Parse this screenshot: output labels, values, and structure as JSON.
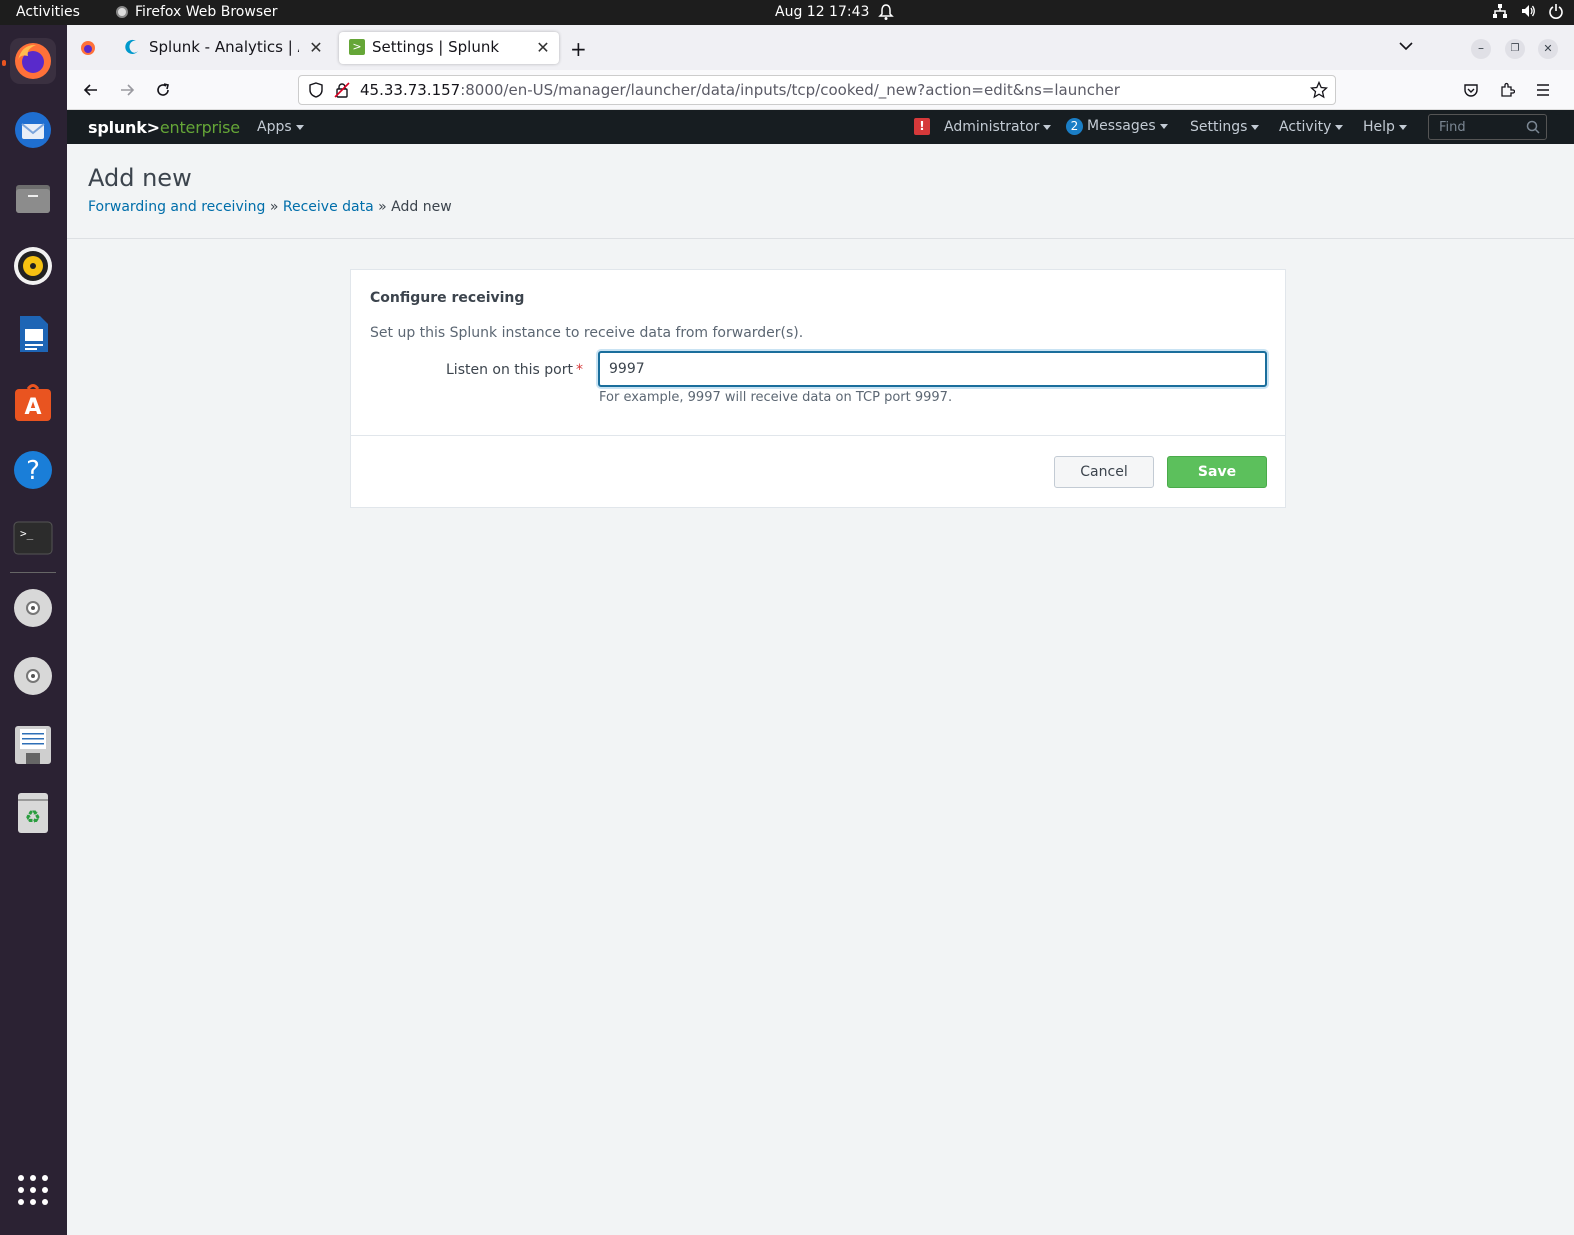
{
  "system": {
    "activities_label": "Activities",
    "app_name": "Firefox Web Browser",
    "clock": "Aug 12  17:43"
  },
  "browser": {
    "tabs": [
      {
        "label": "Splunk - Analytics | Akam",
        "active": false
      },
      {
        "label": "Settings | Splunk",
        "active": true
      }
    ],
    "url_host": "45.33.73.157",
    "url_rest": ":8000/en-US/manager/launcher/data/inputs/tcp/cooked/_new?action=edit&ns=launcher"
  },
  "splunk_header": {
    "logo_main": "splunk>",
    "logo_sub": "enterprise",
    "apps": "Apps",
    "administrator": "Administrator",
    "messages_count": "2",
    "messages": "Messages",
    "settings": "Settings",
    "activity": "Activity",
    "help": "Help",
    "find_placeholder": "Find"
  },
  "page": {
    "title": "Add new",
    "breadcrumb": {
      "item1": "Forwarding and receiving",
      "sep": "»",
      "item2": "Receive data",
      "current": "Add new"
    }
  },
  "form": {
    "title": "Configure receiving",
    "description": "Set up this Splunk instance to receive data from forwarder(s).",
    "port_label": "Listen on this port",
    "port_required": "*",
    "port_value": "9997",
    "port_help": "For example, 9997 will receive data on TCP port 9997.",
    "cancel_label": "Cancel",
    "save_label": "Save"
  },
  "colors": {
    "splunk_green": "#65a637",
    "link_blue": "#006eaa",
    "save_green": "#5cc05c",
    "dock_bg": "#2b2233"
  }
}
